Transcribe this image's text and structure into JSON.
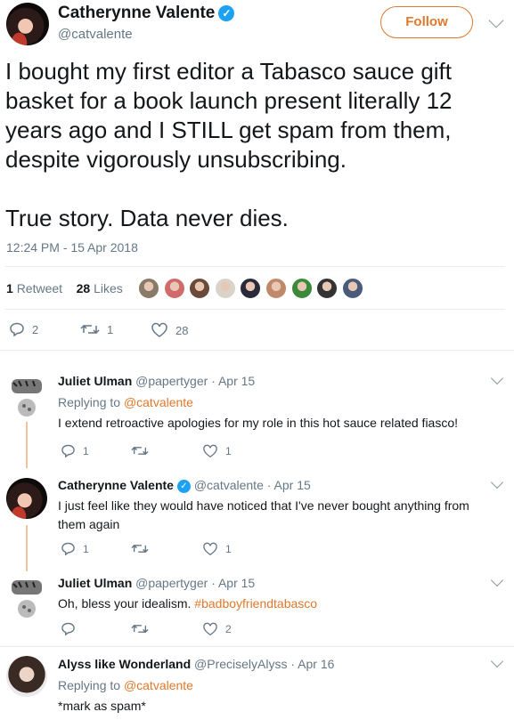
{
  "tweet": {
    "author_name": "Catherynne Valente",
    "author_handle": "@catvalente",
    "follow_label": "Follow",
    "text": "I bought my first editor a Tabasco sauce gift basket for a book launch present literally 12 years ago and I STILL get spam from them, despite vigorously unsubscribing.\n\nTrue story. Data never dies.",
    "timestamp": "12:24 PM - 15 Apr 2018",
    "retweets_count": "1",
    "retweets_label": "Retweet",
    "likes_count": "28",
    "likes_label": "Likes",
    "actions": {
      "replies": "2",
      "retweets": "1",
      "likes": "28"
    }
  },
  "likers": [
    {
      "icon": "liker-avatar",
      "color": "#8a7a6a"
    },
    {
      "icon": "liker-avatar",
      "color": "#d16b6b"
    },
    {
      "icon": "liker-avatar",
      "color": "#6b4a3a"
    },
    {
      "icon": "liker-avatar",
      "color": "#d9d3c9"
    },
    {
      "icon": "liker-avatar",
      "color": "#2a2a3a"
    },
    {
      "icon": "liker-avatar",
      "color": "#c08a6a"
    },
    {
      "icon": "liker-avatar",
      "color": "#3a8a3a"
    },
    {
      "icon": "liker-avatar",
      "color": "#333333"
    },
    {
      "icon": "liker-avatar",
      "color": "#4a5a7a"
    }
  ],
  "replies": [
    {
      "name": "Juliet Ulman",
      "handle": "@papertyger",
      "date": "· Apr 15",
      "replying_prefix": "Replying to",
      "replying_to": "@catvalente",
      "text": "I extend retroactive apologies for my role in this hot sauce related fiasco!",
      "reply_count": "1",
      "retweet_count": "",
      "like_count": "1"
    },
    {
      "name": "Catherynne Valente",
      "handle": "@catvalente",
      "date": "· Apr 15",
      "text": "I just feel like they would have noticed that I've never bought anything from them again",
      "reply_count": "1",
      "retweet_count": "",
      "like_count": "1"
    },
    {
      "name": "Juliet Ulman",
      "handle": "@papertyger",
      "date": "· Apr 15",
      "text_plain": "Oh, bless your idealism.",
      "hashtag": "#badboyfriendtabasco",
      "reply_count": "",
      "retweet_count": "",
      "like_count": "2"
    },
    {
      "name": "Alyss like Wonderland",
      "handle": "@PreciselyAlyss",
      "date": "· Apr 16",
      "replying_prefix": "Replying to",
      "replying_to": "@catvalente",
      "text": "*mark as spam*"
    }
  ],
  "colors": {
    "accent": "#e0782c",
    "muted": "#657786",
    "verified": "#1da1f2",
    "thread_line": "#f5c29a"
  }
}
